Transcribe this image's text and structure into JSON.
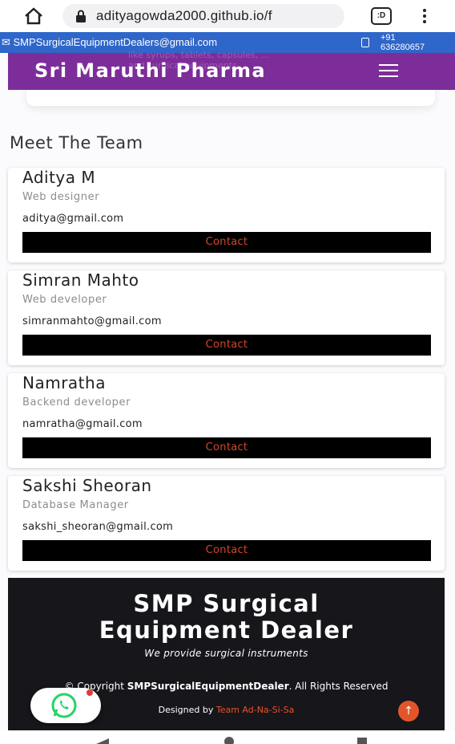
{
  "browser": {
    "url": "adityagowda2000.github.io/f",
    "tabs_count": ":D",
    "icons": [
      "home-icon",
      "lock-icon",
      "tabs-icon",
      "more-options-icon"
    ]
  },
  "info_bar": {
    "email": "SMPSurgicalEquipmentDealers@gmail.com",
    "phone_prefix": "+91",
    "phone_number": "636280657"
  },
  "navbar": {
    "ghost_line_1": "like syrups, tablets, capsules, ...",
    "ghost_line_2": "and surgical equipments",
    "brand": "Sri Maruthi Pharma"
  },
  "section": {
    "title": "Meet The Team"
  },
  "team": [
    {
      "name": "Aditya M",
      "role": "Web designer",
      "email": "aditya@gmail.com",
      "button": "Contact"
    },
    {
      "name": "Simran Mahto",
      "role": "Web developer",
      "email": "simranmahto@gmail.com",
      "button": "Contact"
    },
    {
      "name": "Namratha",
      "role": "Backend developer",
      "email": "namratha@gmail.com",
      "button": "Contact"
    },
    {
      "name": "Sakshi Sheoran",
      "role": "Database Manager",
      "email": "sakshi_sheoran@gmail.com",
      "button": "Contact"
    }
  ],
  "footer": {
    "title_line_1": "SMP Surgical",
    "title_line_2": "Equipment Dealer",
    "tagline": "We provide surgical instruments",
    "copyright_prefix": "© Copyright ",
    "copyright_brand": "SMPSurgicalEquipmentDealer",
    "copyright_suffix": ". All Rights Reserved",
    "designed_prefix": "Designed by ",
    "designed_team": "Team Ad-Na-Si-Sa"
  },
  "floating": {
    "scroll_top_glyph": "↑"
  },
  "colors": {
    "info_bar": "#2f66c9",
    "navbar": "#7d2d9a",
    "contact_text": "#d4462b",
    "footer_bg": "#16161b",
    "accent": "#e2552b",
    "whatsapp": "#25d366"
  }
}
